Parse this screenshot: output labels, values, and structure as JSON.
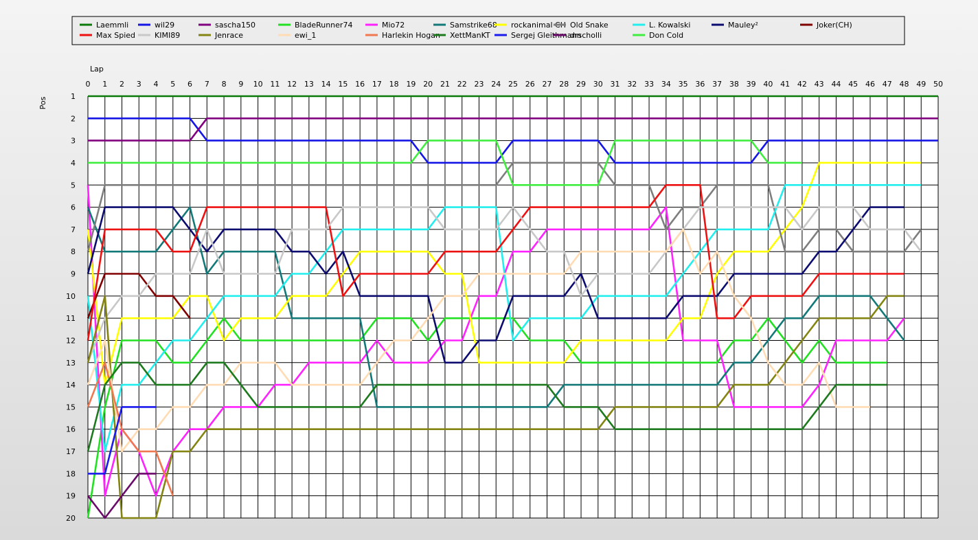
{
  "chart_data": {
    "type": "line",
    "title": "",
    "xlabel": "Lap",
    "ylabel": "Pos",
    "xlim": [
      0,
      50
    ],
    "ylim": [
      1,
      20
    ],
    "y_inverted": true,
    "grid": true,
    "legend_position": "top",
    "x_ticks": [
      "0",
      "1",
      "2",
      "3",
      "4",
      "5",
      "6",
      "7",
      "8",
      "9",
      "10",
      "11",
      "12",
      "13",
      "14",
      "15",
      "16",
      "17",
      "18",
      "19",
      "20",
      "21",
      "22",
      "23",
      "24",
      "25",
      "26",
      "27",
      "28",
      "29",
      "30",
      "31",
      "32",
      "33",
      "34",
      "35",
      "36",
      "37",
      "38",
      "39",
      "40",
      "41",
      "42",
      "43",
      "44",
      "45",
      "46",
      "47",
      "48",
      "49",
      "50"
    ],
    "y_ticks": [
      "1",
      "2",
      "3",
      "4",
      "5",
      "6",
      "7",
      "8",
      "9",
      "10",
      "11",
      "12",
      "13",
      "14",
      "15",
      "16",
      "17",
      "18",
      "19",
      "20"
    ],
    "series": [
      {
        "name": "Laemmli",
        "color": "#0b7a0b",
        "start": 0,
        "values": [
          1,
          1,
          1,
          1,
          1,
          1,
          1,
          1,
          1,
          1,
          1,
          1,
          1,
          1,
          1,
          1,
          1,
          1,
          1,
          1,
          1,
          1,
          1,
          1,
          1,
          1,
          1,
          1,
          1,
          1,
          1,
          1,
          1,
          1,
          1,
          1,
          1,
          1,
          1,
          1,
          1,
          1,
          1,
          1,
          1,
          1,
          1,
          1,
          1,
          1,
          1
        ]
      },
      {
        "name": "wil29",
        "color": "#1515e6",
        "start": 0,
        "values": [
          2,
          2,
          2,
          2,
          2,
          2,
          2,
          3,
          3,
          3,
          3,
          3,
          3,
          3,
          3,
          3,
          3,
          3,
          3,
          3,
          4,
          4,
          4,
          4,
          4,
          3,
          3,
          3,
          3,
          3,
          3,
          4,
          4,
          4,
          4,
          4,
          4,
          4,
          4,
          4,
          3,
          3,
          3,
          3,
          3,
          3,
          3,
          3,
          3,
          3,
          3
        ]
      },
      {
        "name": "sascha150",
        "color": "#800080",
        "start": 0,
        "values": [
          3,
          3,
          3,
          3,
          3,
          3,
          3,
          2,
          2,
          2,
          2,
          2,
          2,
          2,
          2,
          2,
          2,
          2,
          2,
          2,
          2,
          2,
          2,
          2,
          2,
          2,
          2,
          2,
          2,
          2,
          2,
          2,
          2,
          2,
          2,
          2,
          2,
          2,
          2,
          2,
          2,
          2,
          2,
          2,
          2,
          2,
          2,
          2,
          2,
          2,
          2
        ]
      },
      {
        "name": "BladeRunner74",
        "color": "#22e022",
        "start": 0,
        "values": [
          20,
          15,
          12,
          12,
          12,
          13,
          13,
          12,
          11,
          12,
          12,
          12,
          12,
          12,
          12,
          12,
          12,
          11,
          11,
          11,
          12,
          11,
          11,
          11,
          11,
          11,
          12,
          12,
          12,
          13,
          13,
          13,
          13,
          13,
          13,
          13,
          13,
          13,
          12,
          12,
          11,
          12,
          13,
          12,
          13,
          13,
          13,
          13
        ]
      },
      {
        "name": "Mio72",
        "color": "#ff22ff",
        "start": 0,
        "values": [
          5,
          19,
          16,
          17,
          19,
          17,
          16,
          16,
          15,
          15,
          15,
          14,
          14,
          13,
          13,
          13,
          13,
          12,
          13,
          13,
          13,
          12,
          12,
          10,
          10,
          8,
          8,
          7,
          7,
          7,
          7,
          7,
          7,
          7,
          6,
          12,
          12,
          12,
          15,
          15,
          15,
          15,
          15,
          14,
          12,
          12,
          12,
          12,
          11
        ]
      },
      {
        "name": "Samstrike68",
        "color": "#127878",
        "start": 0,
        "values": [
          6,
          8,
          8,
          8,
          8,
          7,
          6,
          9,
          8,
          8,
          8,
          8,
          11,
          11,
          11,
          11,
          11,
          15,
          15,
          15,
          15,
          15,
          15,
          15,
          15,
          15,
          15,
          15,
          14,
          14,
          14,
          14,
          14,
          14,
          14,
          14,
          14,
          14,
          13,
          13,
          12,
          11,
          11,
          10,
          10,
          10,
          10,
          11,
          12
        ]
      },
      {
        "name": "rockanimal CH",
        "color": "#ffff00",
        "start": 0,
        "values": [
          7,
          14,
          11,
          11,
          11,
          11,
          10,
          10,
          12,
          11,
          11,
          11,
          10,
          10,
          10,
          9,
          8,
          8,
          8,
          8,
          8,
          9,
          9,
          13,
          13,
          13,
          13,
          13,
          13,
          12,
          12,
          12,
          12,
          12,
          12,
          11,
          11,
          9,
          8,
          8,
          8,
          7,
          6,
          4,
          4,
          4,
          4,
          4,
          4,
          4
        ]
      },
      {
        "name": "Old Snake",
        "color": "#7e7e7e",
        "start": 0,
        "values": [
          8,
          5,
          5,
          5,
          5,
          5,
          5,
          5,
          5,
          5,
          5,
          5,
          5,
          5,
          5,
          5,
          5,
          5,
          5,
          5,
          5,
          5,
          5,
          5,
          5,
          4,
          4,
          4,
          4,
          4,
          4,
          5,
          5,
          5,
          7,
          6,
          6,
          5,
          5,
          5,
          5,
          8,
          8,
          7,
          7,
          8,
          8,
          8,
          8,
          7
        ]
      },
      {
        "name": "L. Kowalski",
        "color": "#22eeee",
        "start": 0,
        "values": [
          10,
          17,
          14,
          14,
          13,
          12,
          12,
          11,
          10,
          10,
          10,
          10,
          9,
          9,
          8,
          7,
          7,
          7,
          7,
          7,
          7,
          6,
          6,
          6,
          6,
          12,
          11,
          11,
          11,
          11,
          10,
          10,
          10,
          10,
          10,
          9,
          8,
          7,
          7,
          7,
          7,
          5,
          5,
          5,
          5,
          5,
          5,
          5,
          5,
          5
        ]
      },
      {
        "name": "Mauley²",
        "color": "#0c0c70",
        "start": 0,
        "values": [
          9,
          6,
          6,
          6,
          6,
          6,
          7,
          8,
          7,
          7,
          7,
          7,
          8,
          8,
          9,
          8,
          10,
          10,
          10,
          10,
          10,
          13,
          13,
          12,
          12,
          10,
          10,
          10,
          10,
          9,
          11,
          11,
          11,
          11,
          11,
          10,
          10,
          10,
          9,
          9,
          9,
          9,
          9,
          8,
          8,
          7,
          6,
          6,
          6
        ]
      },
      {
        "name": "Joker(CH)",
        "color": "#800000",
        "start": 0,
        "values": [
          11,
          9,
          9,
          9,
          10,
          10,
          11
        ]
      },
      {
        "name": "Max Spied",
        "color": "#ee1111",
        "start": 0,
        "values": [
          12,
          7,
          7,
          7,
          7,
          8,
          8,
          6,
          6,
          6,
          6,
          6,
          6,
          6,
          6,
          10,
          9,
          9,
          9,
          9,
          9,
          8,
          8,
          8,
          8,
          7,
          6,
          6,
          6,
          6,
          6,
          6,
          6,
          6,
          5,
          5,
          5,
          11,
          11,
          10,
          10,
          10,
          10,
          9,
          9,
          9,
          9,
          9,
          9
        ]
      },
      {
        "name": "KIMI89",
        "color": "#c8c8c8",
        "start": 0,
        "values": [
          13,
          11,
          10,
          10,
          9,
          9,
          9,
          7,
          9,
          9,
          9,
          9,
          7,
          7,
          7,
          6,
          6,
          6,
          6,
          6,
          6,
          7,
          7,
          7,
          7,
          6,
          7,
          8,
          8,
          10,
          9,
          9,
          9,
          9,
          8,
          7,
          6,
          6,
          6,
          6,
          6,
          6,
          7,
          6,
          6,
          6,
          7,
          7,
          7,
          8
        ]
      },
      {
        "name": "Jenrace",
        "color": "#848413",
        "start": 0,
        "values": [
          13,
          10,
          20,
          20,
          20,
          17,
          17,
          16,
          16,
          16,
          16,
          16,
          16,
          16,
          16,
          16,
          16,
          16,
          16,
          16,
          16,
          16,
          16,
          16,
          16,
          16,
          16,
          16,
          16,
          16,
          16,
          15,
          15,
          15,
          15,
          15,
          15,
          15,
          14,
          14,
          14,
          13,
          12,
          11,
          11,
          11,
          11,
          10,
          10
        ]
      },
      {
        "name": "ewi_1",
        "color": "#ffdcb4",
        "start": 0,
        "values": [
          14,
          12,
          17,
          16,
          16,
          15,
          15,
          14,
          14,
          13,
          13,
          13,
          14,
          14,
          14,
          14,
          14,
          13,
          12,
          12,
          11,
          10,
          10,
          9,
          9,
          9,
          9,
          9,
          9,
          8,
          8,
          8,
          8,
          8,
          8,
          7,
          9,
          8,
          10,
          11,
          13,
          14,
          14,
          13,
          15,
          15,
          15
        ]
      },
      {
        "name": "Harlekin Hogan",
        "color": "#f07850",
        "start": 0,
        "values": [
          15,
          13,
          16,
          17,
          17,
          19
        ]
      },
      {
        "name": "XettManKT",
        "color": "#1e7a1e",
        "start": 0,
        "values": [
          17,
          14,
          13,
          13,
          14,
          14,
          14,
          13,
          13,
          14,
          15,
          15,
          15,
          15,
          15,
          15,
          15,
          14,
          14,
          14,
          14,
          14,
          14,
          14,
          14,
          14,
          14,
          14,
          15,
          15,
          15,
          16,
          16,
          16,
          16,
          16,
          16,
          16,
          16,
          16,
          16,
          16,
          16,
          15,
          14,
          14,
          14,
          14
        ]
      },
      {
        "name": "Sergej Gleithmann",
        "color": "#1a1aee",
        "start": 0,
        "values": [
          18,
          18,
          15,
          15,
          15
        ]
      },
      {
        "name": "drscholli",
        "color": "#6a0a6a",
        "start": 0,
        "values": [
          19,
          20,
          19,
          18,
          18
        ]
      },
      {
        "name": "Don Cold",
        "color": "#40ee40",
        "start": 0,
        "values": [
          4,
          4,
          4,
          4,
          4,
          4,
          4,
          4,
          4,
          4,
          4,
          4,
          4,
          4,
          4,
          4,
          4,
          4,
          4,
          4,
          3,
          3,
          3,
          3,
          3,
          5,
          5,
          5,
          5,
          5,
          5,
          3,
          3,
          3,
          3,
          3,
          3,
          3,
          3,
          3,
          4,
          4,
          4
        ]
      }
    ]
  }
}
